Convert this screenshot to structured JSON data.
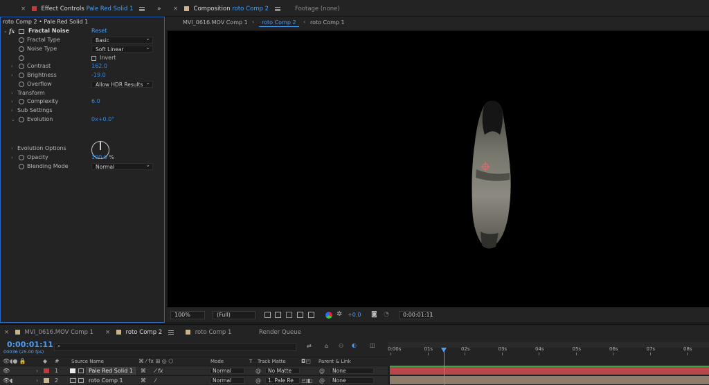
{
  "ec_tab": {
    "prefix": "Effect Controls",
    "layer": "Pale Red Solid 1",
    "swatch": "#c23b3b"
  },
  "ec_breadcrumb": "roto Comp 2 • Pale Red Solid 1",
  "effect": {
    "name": "Fractal Noise",
    "reset": "Reset",
    "fx": "fx",
    "props": [
      {
        "label": "Fractal Type",
        "value": "Basic"
      },
      {
        "label": "Noise Type",
        "value": "Soft Linear"
      },
      {
        "label": "",
        "value": "Invert"
      },
      {
        "label": "Contrast",
        "value": "162.0"
      },
      {
        "label": "Brightness",
        "value": "-19.0"
      },
      {
        "label": "Overflow",
        "value": "Allow HDR Results"
      },
      {
        "label": "Transform",
        "value": ""
      },
      {
        "label": "Complexity",
        "value": "6.0"
      },
      {
        "label": "Sub Settings",
        "value": ""
      },
      {
        "label": "Evolution",
        "value": "0",
        "value_suffix": "x+0.0°"
      },
      {
        "label": "Evolution Options",
        "value": ""
      },
      {
        "label": "Opacity",
        "value": "100.0",
        "value_suffix": "%"
      },
      {
        "label": "Blending Mode",
        "value": "Normal"
      }
    ]
  },
  "viewer": {
    "tab_prefix": "Composition",
    "tab_comp": "roto Comp 2",
    "footage": "Footage",
    "footage_value": "(none)",
    "breadcrumbs": [
      "MVI_0616.MOV Comp 1",
      "roto Comp 2",
      "roto Comp 1"
    ],
    "zoom": "100%",
    "resolution": "(Full)",
    "exposure": "+0.0",
    "timecode": "0:00:01:11"
  },
  "timeline": {
    "tabs": [
      "MVI_0616.MOV Comp 1",
      "roto Comp 2",
      "roto Comp 1",
      "Render Queue"
    ],
    "active_tab": 1,
    "timecode": "0:00:01:11",
    "frames": "00036 (25.00 fps)",
    "search_placeholder": "",
    "columns": {
      "num": "#",
      "source": "Source Name",
      "mode": "Mode",
      "t": "T",
      "matte": "Track Matte",
      "parent": "Parent & Link"
    },
    "ruler": [
      "0:00s",
      "01s",
      "02s",
      "03s",
      "04s",
      "05s",
      "06s",
      "07s",
      "08s"
    ],
    "playhead_seconds": 1.44,
    "layers": [
      {
        "num": "1",
        "name": "Pale Red Solid 1",
        "label_color": "#c23b3b",
        "mode": "Normal",
        "matte": "No Matte",
        "parent": "None",
        "bar_color": "#b9464b"
      },
      {
        "num": "2",
        "name": "roto Comp 1",
        "label_color": "#c8b58a",
        "mode": "Normal",
        "matte": "1. Pale Re",
        "parent": "None",
        "bar_color": "#8f7d6c"
      }
    ]
  }
}
